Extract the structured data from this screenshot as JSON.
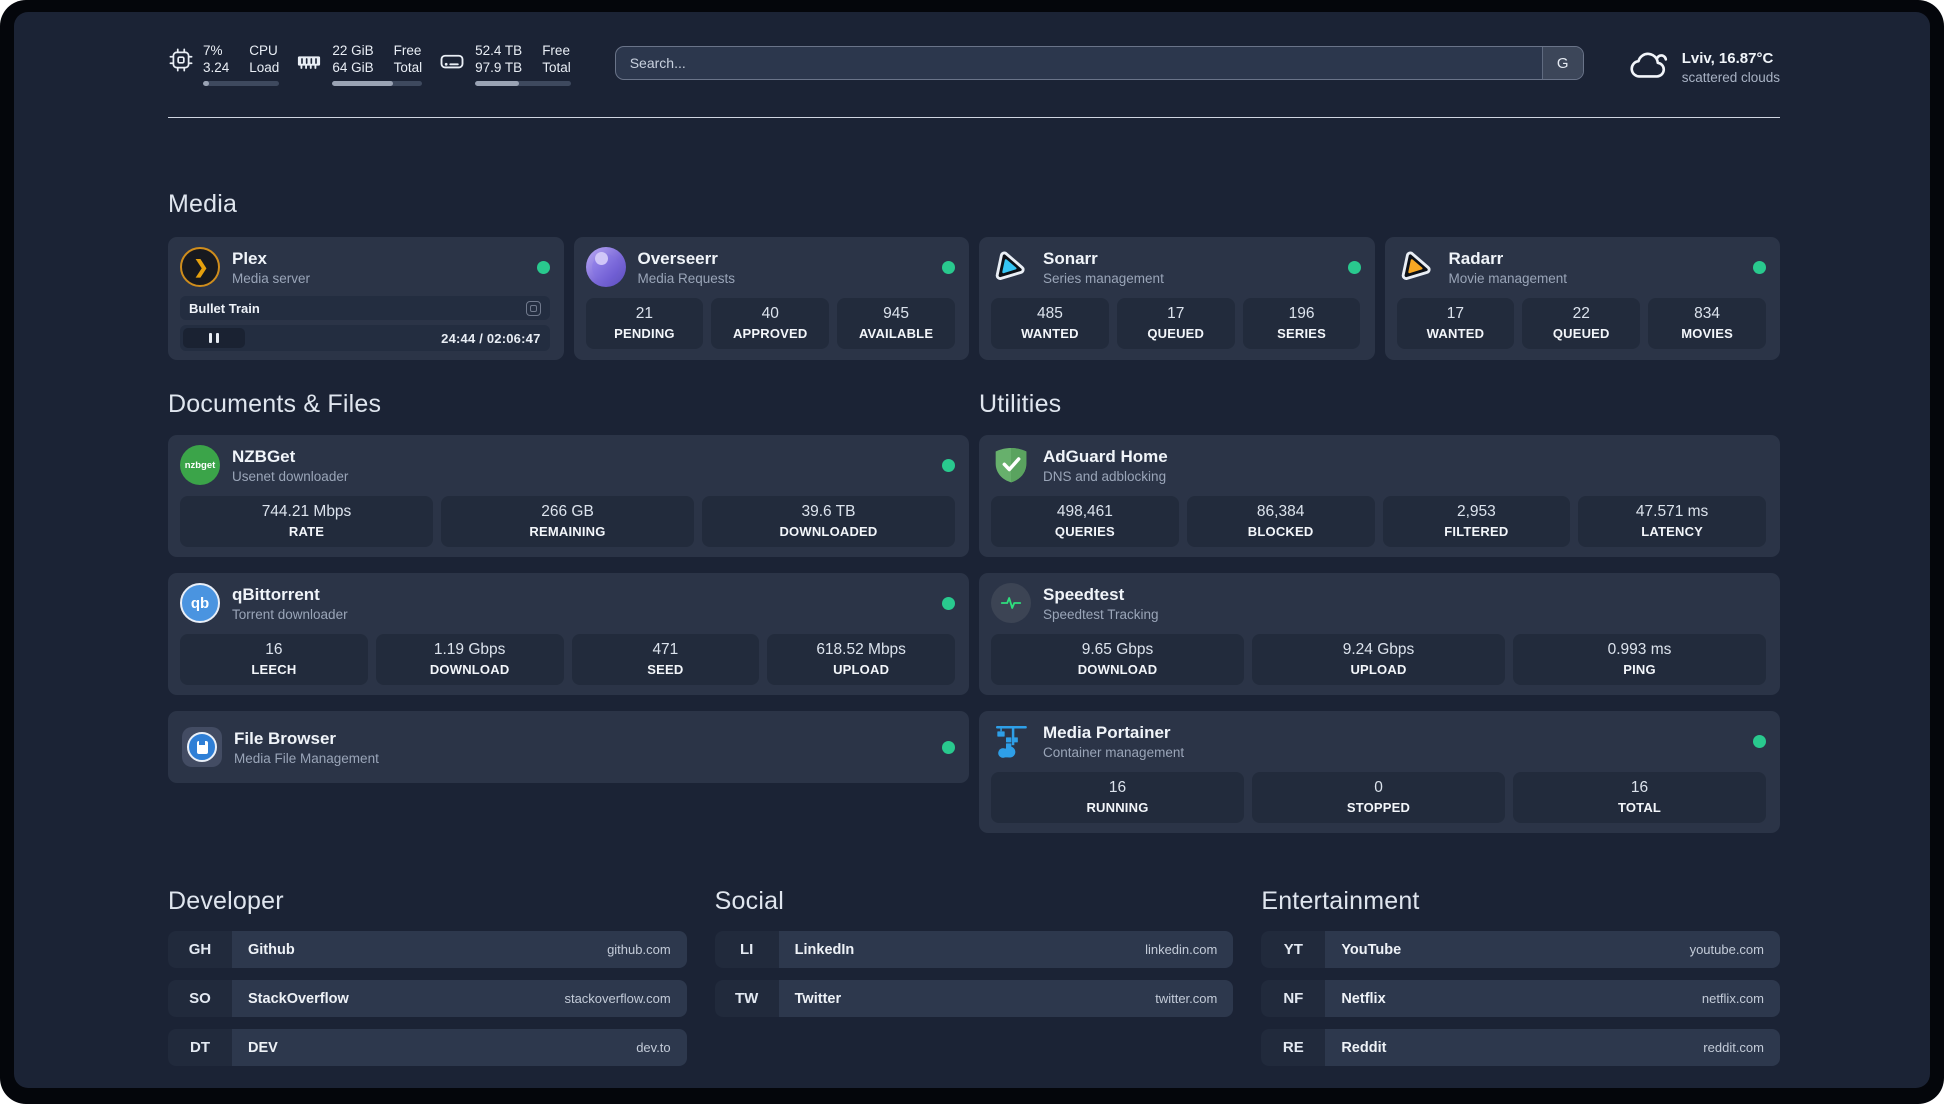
{
  "header": {
    "cpu": {
      "value_top": "7%",
      "value_bottom": "3.24",
      "label_top": "CPU",
      "label_bottom": "Load",
      "progress_percent": 8
    },
    "ram": {
      "value_top": "22 GiB",
      "value_bottom": "64 GiB",
      "label_top": "Free",
      "label_bottom": "Total",
      "progress_percent": 68
    },
    "disk": {
      "value_top": "52.4 TB",
      "value_bottom": "97.9 TB",
      "label_top": "Free",
      "label_bottom": "Total",
      "progress_percent": 46
    },
    "search": {
      "placeholder": "Search...",
      "provider_label": "G"
    },
    "weather": {
      "location": "Lviv, 16.87°C",
      "condition": "scattered clouds"
    }
  },
  "colors": {
    "status_online": "#29c98e",
    "background": "#1b2335",
    "card": "#2b3447",
    "tile": "#222b3c"
  },
  "sections": {
    "media": {
      "title": "Media",
      "apps": {
        "plex": {
          "name": "Plex",
          "description": "Media server",
          "status": "online",
          "session": {
            "title": "Bullet Train",
            "state": "paused",
            "progress_time": "24:44 / 02:06:47"
          }
        },
        "overseerr": {
          "name": "Overseerr",
          "description": "Media Requests",
          "status": "online",
          "stats": [
            {
              "value": "21",
              "label": "PENDING"
            },
            {
              "value": "40",
              "label": "APPROVED"
            },
            {
              "value": "945",
              "label": "AVAILABLE"
            }
          ]
        },
        "sonarr": {
          "name": "Sonarr",
          "description": "Series management",
          "status": "online",
          "stats": [
            {
              "value": "485",
              "label": "WANTED"
            },
            {
              "value": "17",
              "label": "QUEUED"
            },
            {
              "value": "196",
              "label": "SERIES"
            }
          ]
        },
        "radarr": {
          "name": "Radarr",
          "description": "Movie management",
          "status": "online",
          "stats": [
            {
              "value": "17",
              "label": "WANTED"
            },
            {
              "value": "22",
              "label": "QUEUED"
            },
            {
              "value": "834",
              "label": "MOVIES"
            }
          ]
        }
      }
    },
    "documents": {
      "title": "Documents & Files",
      "apps": {
        "nzbget": {
          "name": "NZBGet",
          "description": "Usenet downloader",
          "status": "online",
          "stats": [
            {
              "value": "744.21 Mbps",
              "label": "RATE"
            },
            {
              "value": "266 GB",
              "label": "REMAINING"
            },
            {
              "value": "39.6 TB",
              "label": "DOWNLOADED"
            }
          ]
        },
        "qbittorrent": {
          "name": "qBittorrent",
          "description": "Torrent downloader",
          "status": "online",
          "stats": [
            {
              "value": "16",
              "label": "LEECH"
            },
            {
              "value": "1.19 Gbps",
              "label": "DOWNLOAD"
            },
            {
              "value": "471",
              "label": "SEED"
            },
            {
              "value": "618.52 Mbps",
              "label": "UPLOAD"
            }
          ]
        },
        "filebrowser": {
          "name": "File Browser",
          "description": "Media File Management",
          "status": "online"
        }
      }
    },
    "utilities": {
      "title": "Utilities",
      "apps": {
        "adguard": {
          "name": "AdGuard Home",
          "description": "DNS and adblocking",
          "stats": [
            {
              "value": "498,461",
              "label": "QUERIES"
            },
            {
              "value": "86,384",
              "label": "BLOCKED"
            },
            {
              "value": "2,953",
              "label": "FILTERED"
            },
            {
              "value": "47.571 ms",
              "label": "LATENCY"
            }
          ]
        },
        "speedtest": {
          "name": "Speedtest",
          "description": "Speedtest Tracking",
          "stats": [
            {
              "value": "9.65 Gbps",
              "label": "DOWNLOAD"
            },
            {
              "value": "9.24 Gbps",
              "label": "UPLOAD"
            },
            {
              "value": "0.993 ms",
              "label": "PING"
            }
          ]
        },
        "portainer": {
          "name": "Media Portainer",
          "description": "Container management",
          "status": "online",
          "stats": [
            {
              "value": "16",
              "label": "RUNNING"
            },
            {
              "value": "0",
              "label": "STOPPED"
            },
            {
              "value": "16",
              "label": "TOTAL"
            }
          ]
        }
      }
    }
  },
  "bookmarks": {
    "developer": {
      "title": "Developer",
      "items": [
        {
          "abbr": "GH",
          "name": "Github",
          "url": "github.com"
        },
        {
          "abbr": "SO",
          "name": "StackOverflow",
          "url": "stackoverflow.com"
        },
        {
          "abbr": "DT",
          "name": "DEV",
          "url": "dev.to"
        }
      ]
    },
    "social": {
      "title": "Social",
      "items": [
        {
          "abbr": "LI",
          "name": "LinkedIn",
          "url": "linkedin.com"
        },
        {
          "abbr": "TW",
          "name": "Twitter",
          "url": "twitter.com"
        }
      ]
    },
    "entertainment": {
      "title": "Entertainment",
      "items": [
        {
          "abbr": "YT",
          "name": "YouTube",
          "url": "youtube.com"
        },
        {
          "abbr": "NF",
          "name": "Netflix",
          "url": "netflix.com"
        },
        {
          "abbr": "RE",
          "name": "Reddit",
          "url": "reddit.com"
        }
      ]
    }
  }
}
